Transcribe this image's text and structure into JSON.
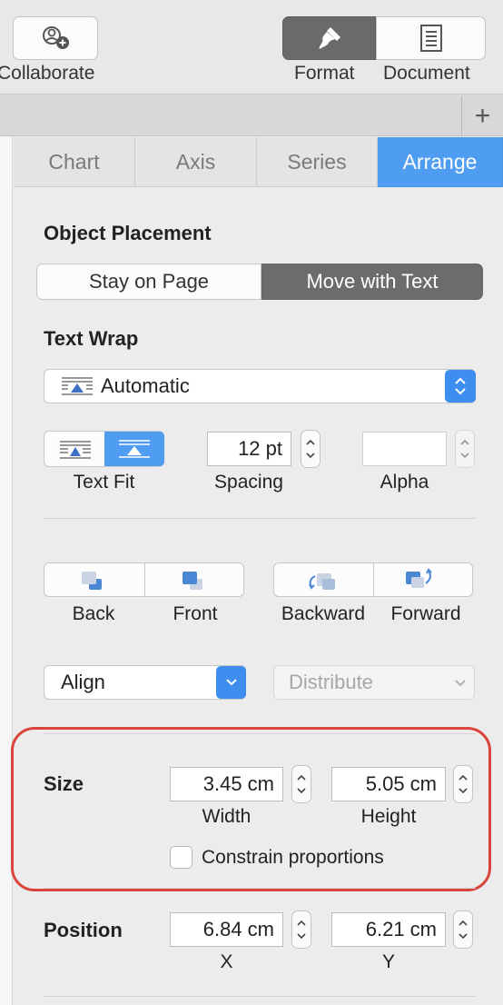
{
  "toolbar": {
    "collaborate_label": "Collaborate",
    "format_label": "Format",
    "document_label": "Document",
    "plus_label": "+"
  },
  "tabs": [
    {
      "label": "Chart",
      "active": false
    },
    {
      "label": "Axis",
      "active": false
    },
    {
      "label": "Series",
      "active": false
    },
    {
      "label": "Arrange",
      "active": true
    }
  ],
  "object_placement": {
    "heading": "Object Placement",
    "options": [
      "Stay on Page",
      "Move with Text"
    ],
    "selected": "Move with Text"
  },
  "text_wrap": {
    "heading": "Text Wrap",
    "selected": "Automatic",
    "text_fit_label": "Text Fit",
    "spacing_value": "12 pt",
    "spacing_label": "Spacing",
    "alpha_value": "",
    "alpha_label": "Alpha"
  },
  "layering": {
    "back_label": "Back",
    "front_label": "Front",
    "backward_label": "Backward",
    "forward_label": "Forward"
  },
  "align": {
    "align_label": "Align",
    "distribute_label": "Distribute"
  },
  "size": {
    "heading": "Size",
    "width_value": "3.45 cm",
    "width_label": "Width",
    "height_value": "5.05 cm",
    "height_label": "Height",
    "constrain_label": "Constrain proportions",
    "constrain_checked": false
  },
  "position": {
    "heading": "Position",
    "x_value": "6.84 cm",
    "x_label": "X",
    "y_value": "6.21 cm",
    "y_label": "Y"
  },
  "colors": {
    "accent": "#4f9df0",
    "highlight": "#d9453a"
  }
}
